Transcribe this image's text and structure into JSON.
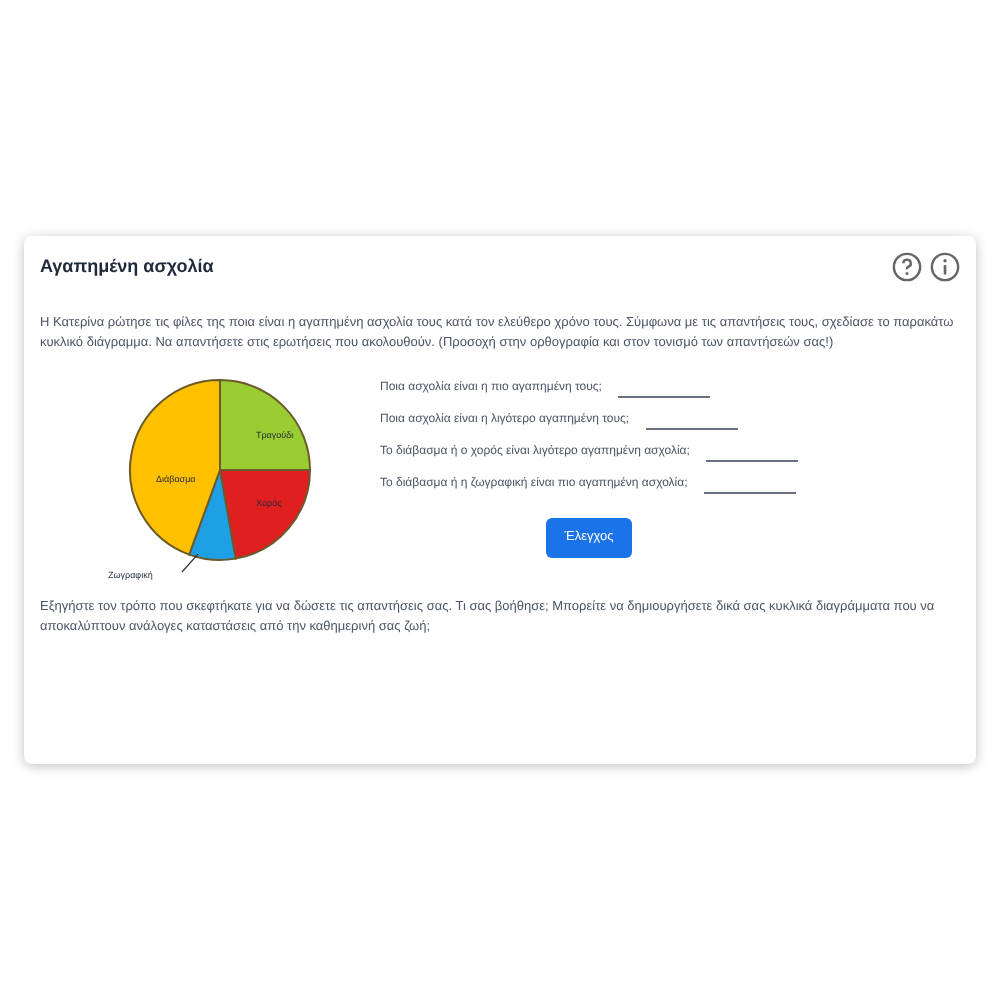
{
  "card": {
    "title": "Αγαπημένη ασχολία"
  },
  "intro": "Η Κατερίνα ρώτησε τις φίλες της ποια είναι η αγαπημένη ασχολία τους κατά τον ελεύθερο χρόνο τους. Σύμφωνα με τις απαντήσεις τους, σχεδίασε το παρακάτω κυκλικό διάγραμμα. Να απαντήσετε στις ερωτήσεις που ακολουθούν. (Προσοχή στην ορθογραφία και στον τονισμό των απαντήσεών σας!)",
  "pie_slices": [
    {
      "label": "Τραγούδι",
      "color": "#9acd32"
    },
    {
      "label": "Χορός",
      "color": "#e02020"
    },
    {
      "label": "Ζωγραφική",
      "color": "#1ea0e6"
    },
    {
      "label": "Διάβασμα",
      "color": "#ffc000"
    }
  ],
  "questions": [
    "Ποια ασχολία είναι η πιο αγαπημένη τους;",
    "Ποια ασχολία είναι η λιγότερο αγαπημένη τους;",
    "Το διάβασμα ή ο χορός είναι λιγότερο αγαπημένη ασχολία;",
    "Το διάβασμα ή η ζωγραφική είναι πιο αγαπημένη ασχολία;"
  ],
  "check_button": "Έλεγχος",
  "footer": "Εξηγήστε τον τρόπο που σκεφτήκατε για να δώσετε τις απαντήσεις σας. Τι σας βοήθησε; Μπορείτε να δημιουργήσετε δικά σας κυκλικά διαγράμματα που να αποκαλύπτουν ανάλογες καταστάσεις από την καθημερινή σας ζωή;"
}
